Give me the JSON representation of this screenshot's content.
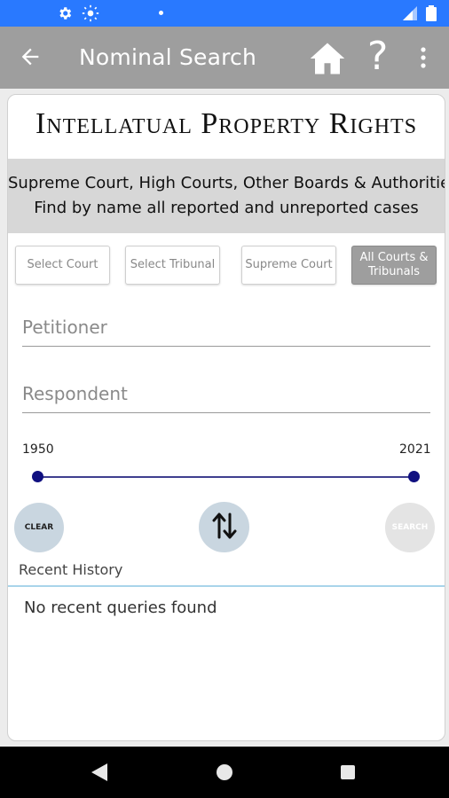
{
  "status_bar": {
    "icons": [
      "settings-gear-icon",
      "brightness-icon",
      "notification-dot-icon",
      "signal-icon",
      "battery-icon"
    ]
  },
  "app_bar": {
    "title": "Nominal Search",
    "icons": [
      "back-arrow-icon",
      "home-icon",
      "help-icon",
      "more-vert-icon"
    ],
    "help_glyph": "?"
  },
  "brand": {
    "title": "Intellatual Property Rights"
  },
  "subtitle": {
    "line1": "Supreme Court, High Courts, Other Boards & Authorities",
    "line2": "Find by name all reported and unreported cases"
  },
  "filters": {
    "chips": [
      {
        "label": "Select Court",
        "active": false
      },
      {
        "label": "Select Tribunal",
        "active": false
      },
      {
        "label": "Supreme Court",
        "active": false
      },
      {
        "label": "All Courts & Tribunals",
        "active": true
      }
    ]
  },
  "form": {
    "petitioner": {
      "placeholder": "Petitioner",
      "value": ""
    },
    "respondent": {
      "placeholder": "Respondent",
      "value": ""
    }
  },
  "year_range": {
    "min_label": "1950",
    "max_label": "2021",
    "selected_min": 1950,
    "selected_max": 2021
  },
  "actions": {
    "clear_label": "CLEAR",
    "search_label": "SEARCH",
    "swap_icon": "swap-vertical-icon"
  },
  "recent": {
    "label": "Recent History",
    "empty_text": "No recent queries found"
  },
  "colors": {
    "status_bar": "#2979ff",
    "app_bar": "#9e9e9e",
    "slider": "#101080",
    "action_button": "#c9d6e0",
    "divider": "#a9d4ea"
  }
}
